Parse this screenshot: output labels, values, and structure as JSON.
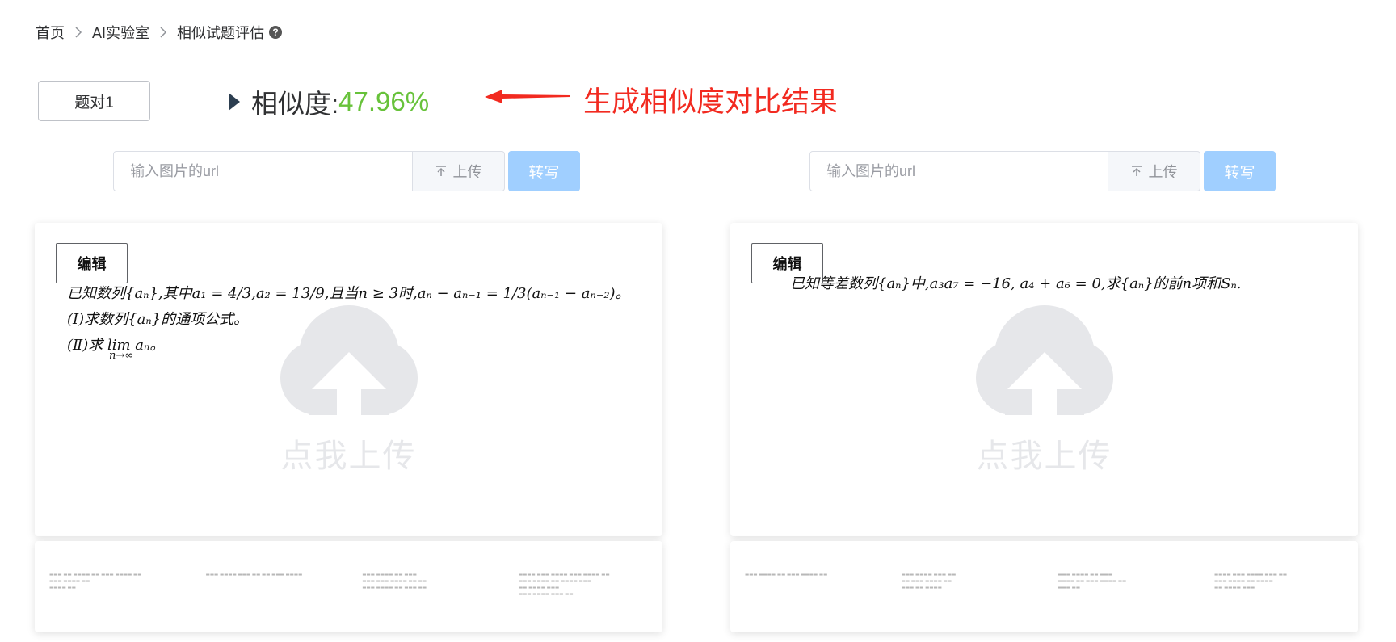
{
  "breadcrumb": {
    "items": [
      "首页",
      "AI实验室",
      "相似试题评估"
    ]
  },
  "pair_button": "题对1",
  "similarity": {
    "label": "相似度:",
    "value": "47.96%"
  },
  "annotation": "生成相似度对比结果",
  "left": {
    "url_placeholder": "输入图片的url",
    "upload_label": "上传",
    "transcribe_label": "转写",
    "edit_label": "编辑",
    "placeholder_text": "点我上传",
    "question_lines": [
      "已知数列{aₙ},其中a₁ = 4/3,a₂ = 13/9,且当n ≥ 3时,aₙ − aₙ₋₁ = 1/3(aₙ₋₁ − aₙ₋₂)。",
      "(Ⅰ)求数列{aₙ}的通项公式。",
      "(Ⅱ)求 lim aₙ。",
      "n→∞"
    ]
  },
  "right": {
    "url_placeholder": "输入图片的url",
    "upload_label": "上传",
    "transcribe_label": "转写",
    "edit_label": "编辑",
    "placeholder_text": "点我上传",
    "question_lines": [
      "已知等差数列{aₙ}中,a₃a₇ = −16, a₄ + a₆ = 0,求{aₙ}的前n项和Sₙ."
    ]
  },
  "colors": {
    "accent_green": "#67c23a",
    "annotation_red": "#f22a20",
    "button_disabled_blue": "#a0cfff"
  },
  "icons": [
    "chevron-right-icon",
    "help-circle-icon",
    "play-triangle-icon",
    "upload-arrow-icon",
    "cloud-upload-icon",
    "red-arrow-icon"
  ]
}
